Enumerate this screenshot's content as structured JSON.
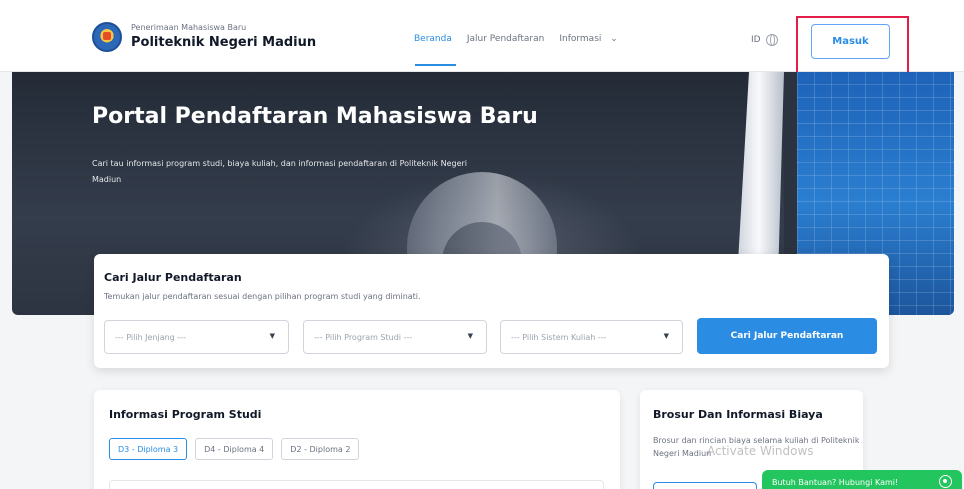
{
  "header": {
    "brand_subtitle": "Penerimaan Mahasiswa Baru",
    "brand_title": "Politeknik Negeri Madiun",
    "nav": [
      {
        "label": "Beranda",
        "active": true
      },
      {
        "label": "Jalur Pendaftaran",
        "active": false
      },
      {
        "label": "Informasi",
        "active": false
      }
    ],
    "language": "ID",
    "login_label": "Masuk"
  },
  "hero": {
    "title": "Portal Pendaftaran Mahasiswa Baru",
    "description": "Cari tau informasi program studi, biaya kuliah, dan informasi pendaftaran di Politeknik Negeri Madiun"
  },
  "search": {
    "title": "Cari Jalur Pendaftaran",
    "subtitle": "Temukan jalur pendaftaran sesuai dengan pilihan program studi yang diminati.",
    "select_jenjang": "--- Pilih Jenjang ---",
    "select_prodi": "--- Pilih Program Studi ---",
    "select_sistem": "--- Pilih Sistem Kuliah ---",
    "button_label": "Cari Jalur Pendaftaran"
  },
  "program": {
    "title": "Informasi Program Studi",
    "tabs": [
      {
        "label": "D3 - Diploma 3",
        "active": true
      },
      {
        "label": "D4 - Diploma 4",
        "active": false
      },
      {
        "label": "D2 - Diploma 2",
        "active": false
      }
    ]
  },
  "brochure": {
    "title": "Brosur Dan Informasi Biaya",
    "description": "Brosur dan rincian biaya selama kuliah di Politeknik Negeri Madiun"
  },
  "watermark": "Activate Windows",
  "help_chat": "Butuh Bantuan? Hubungi Kami!",
  "colors": {
    "accent": "#2a8de3",
    "highlight": "#e11d48",
    "help": "#22c55e"
  }
}
